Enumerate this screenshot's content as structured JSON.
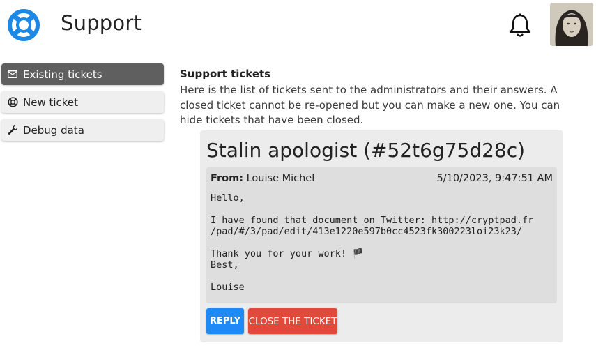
{
  "header": {
    "title": "Support",
    "logo_icon": "lifebuoy-icon",
    "notifications_icon": "bell-icon",
    "avatar": "user-avatar"
  },
  "sidebar": {
    "items": [
      {
        "label": "Existing tickets",
        "icon": "envelope-icon",
        "active": true
      },
      {
        "label": "New ticket",
        "icon": "lifebuoy-icon",
        "active": false
      },
      {
        "label": "Debug data",
        "icon": "wrench-icon",
        "active": false
      }
    ]
  },
  "main": {
    "title": "Support tickets",
    "description": "Here is the list of tickets sent to the administrators and their answers. A closed ticket cannot be re-opened but you can make a new one. You can hide tickets that have been closed."
  },
  "ticket": {
    "title": "Stalin apologist (#52t6g75d28c)",
    "message": {
      "from_label": "From:",
      "from_name": "Louise Michel",
      "date": "5/10/2023, 9:47:51 AM",
      "body": "Hello,\n\nI have found that document on Twitter: http://cryptpad.fr\n/pad/#/3/pad/edit/413e1220e597b0cc4523fk300223loi23k23/\n\nThank you for your work! 🏴\nBest,\n\nLouise"
    },
    "reply_label": "REPLY",
    "close_label": "CLOSE THE TICKET"
  },
  "colors": {
    "accent": "#1f89f5",
    "danger": "#e14a3a",
    "sidebar_active": "#5f5f5f"
  }
}
